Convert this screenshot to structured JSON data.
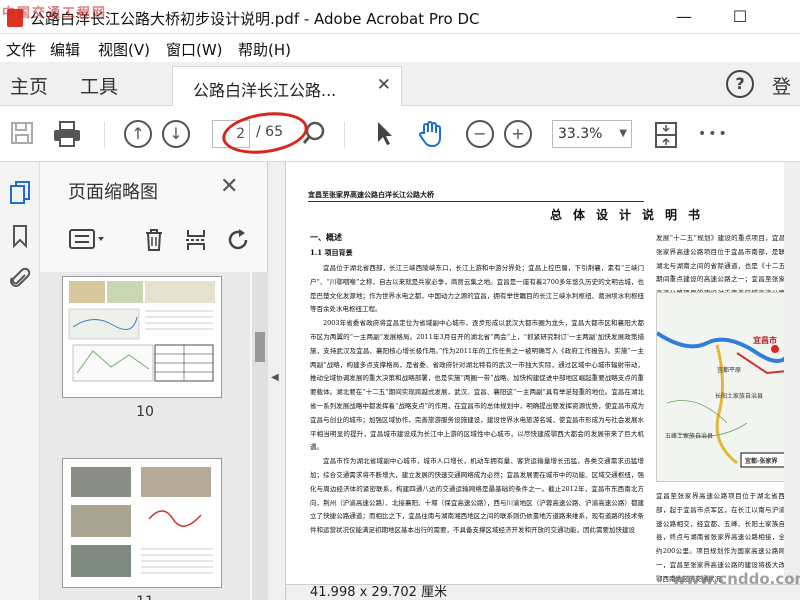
{
  "window": {
    "title": "公路白洋长江公路大桥初步设计说明.pdf - Adobe Acrobat Pro DC",
    "minimize_glyph": "—",
    "maximize_glyph": "☐"
  },
  "menu": [
    {
      "label": "文件"
    },
    {
      "label": "编辑"
    },
    {
      "label": "视图(V)"
    },
    {
      "label": "窗口(W)"
    },
    {
      "label": "帮助(H)"
    }
  ],
  "nav": {
    "home_label": "主页",
    "tools_label": "工具",
    "doc_tab_label": "公路白洋长江公路...",
    "help_glyph": "?",
    "login_label": "登"
  },
  "toolbar": {
    "current_page": "2",
    "total_pages": "/ 65",
    "zoom_level": "33.3%",
    "more_glyph": "•••"
  },
  "side_panel": {
    "title": "页面缩略图",
    "thumbnails": [
      {
        "page_label": "10"
      },
      {
        "page_label": "11"
      }
    ]
  },
  "document": {
    "header": "宜昌至张家界高速公路白洋长江公路大桥",
    "heading": "总体设计说明书",
    "section": "一、概述",
    "subsection": "1.1 项目背景",
    "paragraphs": [
      "宜昌位于湖北省西部，长江三峡西陵峡东口，长江上游和中游分界处；宜昌上控巴蜀，下引荆襄，素有“三峡门户”、“川鄂咽喉”之称，自古以来就是兵家必争，商贾云集之地。宜昌是一座有着2700多年悠久历史的文明古城，也是巴楚文化发源地；作为世界水电之都，中国动力之源的宜昌，拥有举世瞩目的长江三峡水利枢纽、葛洲坝水利枢纽等百余处水电枢纽工程。",
      "2003年省委省政府将宜昌定位为省域副中心城市，逐步形成以武汉大都市圈为龙头，宜昌大都市区和襄阳大都市区为两翼的“一主两副”发展格局。2011年3月召开的湖北省“两会”上，“抓紧研究制订‘一主两副’加快发展政策措施，支持武汉及宜昌、襄阳核心增长极作用。”作为2011年的工作任务之一被明确写入《政府工作报告》。实施“一主两副”战略，构建多点支撑格局，是省委、省政府针对湖北特有的武汉一市独大实际，通过区域中心城市辐射带动，推动全域协调发展的重大决策和战略部署，也是实施“两圈一带”战略、加快构建促进中部地区崛起重要战略支点的重要载体。湖北要在“十二五”期间实现跨越式发展，武汉、宜昌、襄阳这“一主两副”具有举足轻重的地位。宜昌在湖北省一系列发展战略中都发挥着“战略支点”的作用，在宜昌市的总体规划中，明确提出要发挥资源优势，使宜昌市成为宜昌与创业的城市；加强区域协作，完善旅游服务设施建设，建设世界水电旅游名城，使宜昌市形成为与社会发展水平相当明显的提升，宜昌城市建设成为长江中上游的区域性中心城市，以尽快建成鄂西大都会的发展带来了巨大机遇。",
      "宜昌市作为湖北省域副中心城市，城市人口增长，机动车拥有量、客货运输量增长迅猛，各类交通需求迅猛增加；综合交通需求将不断增大，建立发展的快速交通网络成为必然；宜昌发展要在城市中的功能、区域交通枢纽，强化与周边经济体的紧密联系，构建四通八达的交通运输网络是最基础的条件之一。截止2012年，宜昌市东西南北方向，荆州（沪渝高速公路）、北接襄阳、十堰（保宜高速公路），西与川渝地区（沪蓉高速公路、沪渝高速公路）都建立了快捷公路通道；而相比之下，宜昌往南与湖南湘西地区之间的联系则仍依靠地方道路来维系，现有道路的技术条件和运营状况仅能满足初期地区基本出行的需要，不具备支撑区域经济开发和开放的交通功能，因此需要加快建设"
    ],
    "right_column_text": "发展“十二五”规划》建设的重点项目，宜昌至张家界高速公路项目位于宜昌市南部，是联系湖北与湖南之间的省际通道，也是《十二五》期间重点建设的高速公路之一；宜昌至张家界高速公路项目的建设对于完善区域高速公路网络、改善区域交通条件、促进沿线经济社会发展具有十分重要的意义。",
    "right_column_lower": "宜昌至张家界高速公路项目位于湖北省西南部，起于宜昌市点军区，在长江以南与沪渝高速公路相交，经宜都、五峰、长阳土家族自治县，终点与湖南省张家界高速公路相接，全长约200公里。项目规划作为国家高速公路网之一，宜昌至张家界高速公路的建设将极大改善鄂西南地区的交通状况。",
    "map_labels": {
      "city": "宜昌市",
      "county": "长阳土家族自治县",
      "region": "五峰土家族自治县",
      "route": "宜都-张家界",
      "plain": "宜都平原"
    },
    "page_size": "41.998 x 29.702 厘米"
  },
  "watermarks": {
    "top_left": "中国交通工程网",
    "bottom_right": "www.cnddo.com"
  }
}
